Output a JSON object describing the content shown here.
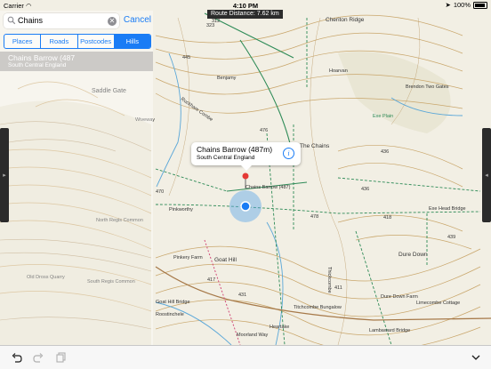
{
  "status_bar": {
    "carrier": "Carrier",
    "time": "4:10 PM",
    "battery": "100%"
  },
  "route_distance": "Route Distance: 7.62 km",
  "search": {
    "value": "Chains",
    "cancel_label": "Cancel"
  },
  "tabs": [
    {
      "label": "Places",
      "active": false
    },
    {
      "label": "Roads",
      "active": false
    },
    {
      "label": "Postcodes",
      "active": false
    },
    {
      "label": "Hills",
      "active": true
    }
  ],
  "results": [
    {
      "title": "Chains Barrow (487",
      "subtitle": "South Central England"
    }
  ],
  "callout": {
    "title": "Chains Barrow (487m)",
    "subtitle": "South Central England"
  },
  "map_labels": {
    "saddle_gate": "Saddle Gate",
    "wiveway": "Wiveway",
    "north_regis_common": "North Regis Common",
    "south_regis_common": "South Regis Common",
    "old_dross_quarry": "Old Dross Quarry",
    "pinkworthy": "Pinkworthy",
    "pinkery_farm": "Pinkery Farm",
    "goat_hill": "Goat Hill",
    "goat_hill_bridge": "Goat Hill Bridge",
    "roostinchele": "Roostinchele",
    "moorland_way": "Moorland Way",
    "heartake": "Heartake",
    "benjamy": "Benjamy",
    "ruckham_combe": "Ruckham Combe",
    "cheriton_ridge": "Cheriton Ridge",
    "hoarvan": "Hoarvan",
    "exe_plain": "Exe Plain",
    "the_chains": "The Chains",
    "chains_barrow_label": "Chains Barrow (487)",
    "brendon_two_gates": "Brendon Two Gates",
    "exe_head_bridge": "Exe Head Bridge",
    "dure_down": "Dure Down",
    "dure_down_farm": "Dure Down Farm",
    "limecombe_cottage": "Limecombe Cottage",
    "titchcombe_bungalow": "Titchcombe Bungalow",
    "thickcombe": "Thickcombe",
    "lambaward_bridge": "Lambaward Bridge",
    "spot_heights": [
      "323",
      "312",
      "445",
      "476",
      "478",
      "436",
      "436",
      "418",
      "439",
      "417",
      "411",
      "431",
      "470"
    ]
  },
  "colors": {
    "accent": "#1a7cf5",
    "map_background": "#f2efe4",
    "contour": "#c9a66b",
    "green_path": "#2e8b57",
    "water": "#5aa7d8"
  },
  "icons": {
    "search": "magnifier-icon",
    "clear": "clear-icon",
    "info": "info-icon",
    "undo": "undo-icon",
    "redo": "redo-icon",
    "copy": "copy-icon",
    "chevron": "chevron-down-icon"
  }
}
